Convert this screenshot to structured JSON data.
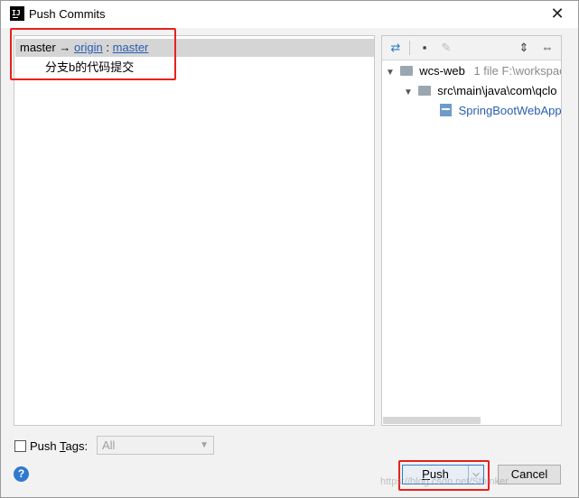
{
  "window": {
    "title": "Push Commits",
    "close_glyph": "✕",
    "app_icon_glyph": "IJ"
  },
  "commits": {
    "branch_row": {
      "local_branch": "master",
      "arrow": "→",
      "remote": "origin",
      "separator": ":",
      "remote_branch": "master"
    },
    "items": [
      {
        "message": "分支b的代码提交"
      }
    ]
  },
  "changes": {
    "toolbar": {
      "diff_glyph": "⇄",
      "group_glyph": "▪",
      "edit_glyph": "✎",
      "expand_glyph": "⇕",
      "collapse_glyph": "⇔"
    },
    "tree": {
      "module": {
        "name": "wcs-web",
        "meta": "1 file  F:\\workspac"
      },
      "folder": {
        "path": "src\\main\\java\\com\\qclo"
      },
      "file": {
        "name": "SpringBootWebApp"
      }
    }
  },
  "bottom": {
    "push_tags_label_prefix": "Push ",
    "push_tags_label_mnemonic": "T",
    "push_tags_label_suffix": "ags:",
    "tags_select_value": "All",
    "help_glyph": "?",
    "push_label_mnemonic": "P",
    "push_label_rest": "ush",
    "push_arrow": "⌵",
    "cancel_label": "Cancel"
  },
  "watermark": "https://blog.csdn.net/Sthinker"
}
